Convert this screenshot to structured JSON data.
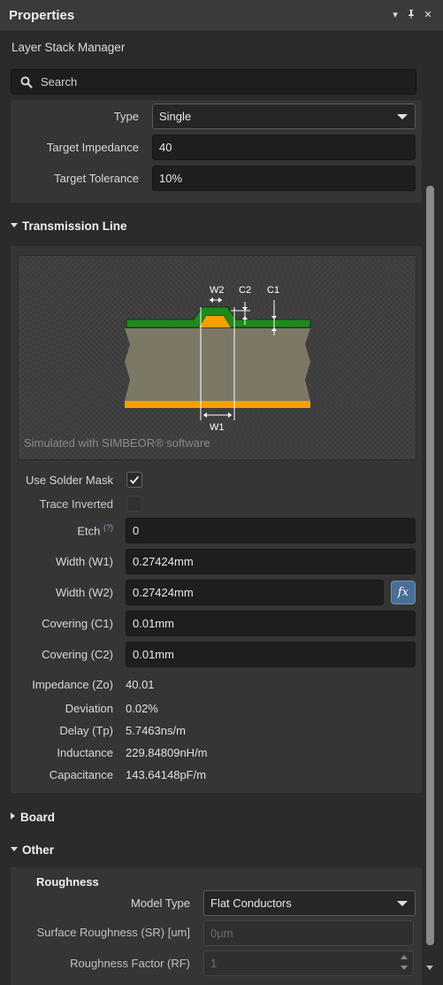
{
  "titlebar": {
    "title": "Properties",
    "menu_icon": "▾",
    "pin_icon": "pin-icon",
    "close_icon": "✕"
  },
  "subtitle": "Layer Stack Manager",
  "search": {
    "placeholder": "Search"
  },
  "general": {
    "type_label": "Type",
    "type_value": "Single",
    "target_impedance_label": "Target Impedance",
    "target_impedance_value": "40",
    "target_tolerance_label": "Target Tolerance",
    "target_tolerance_value": "10%"
  },
  "transmission_line": {
    "header": "Transmission Line",
    "diagram": {
      "w2": "W2",
      "c2": "C2",
      "c1": "C1",
      "w1": "W1",
      "sim_text": "Simulated with SIMBEOR® software"
    },
    "use_solder_mask_label": "Use Solder Mask",
    "use_solder_mask_checked": true,
    "trace_inverted_label": "Trace Inverted",
    "trace_inverted_checked": false,
    "etch_label": "Etch",
    "etch_help": "(?)",
    "etch_value": "0",
    "width_w1_label": "Width (W1)",
    "width_w1_value": "0.27424mm",
    "width_w2_label": "Width (W2)",
    "width_w2_value": "0.27424mm",
    "fx_label": "fx",
    "covering_c1_label": "Covering (C1)",
    "covering_c1_value": "0.01mm",
    "covering_c2_label": "Covering (C2)",
    "covering_c2_value": "0.01mm",
    "results": [
      {
        "label": "Impedance (Zo)",
        "value": "40.01"
      },
      {
        "label": "Deviation",
        "value": "0.02%"
      },
      {
        "label": "Delay (Tp)",
        "value": "5.7463ns/m"
      },
      {
        "label": "Inductance",
        "value": "229.84809nH/m"
      },
      {
        "label": "Capacitance",
        "value": "143.64148pF/m"
      }
    ]
  },
  "board": {
    "header": "Board"
  },
  "other": {
    "header": "Other",
    "roughness_header": "Roughness",
    "model_type_label": "Model Type",
    "model_type_value": "Flat Conductors",
    "surface_roughness_label": "Surface Roughness (SR) [um]",
    "surface_roughness_placeholder": "0µm",
    "roughness_factor_label": "Roughness Factor (RF)",
    "roughness_factor_placeholder": "1"
  },
  "colors": {
    "solder_mask": "#1e8a1e",
    "copper": "#f5a000",
    "dielectric": "#7d7866",
    "accent_button": "#4a6f96"
  }
}
